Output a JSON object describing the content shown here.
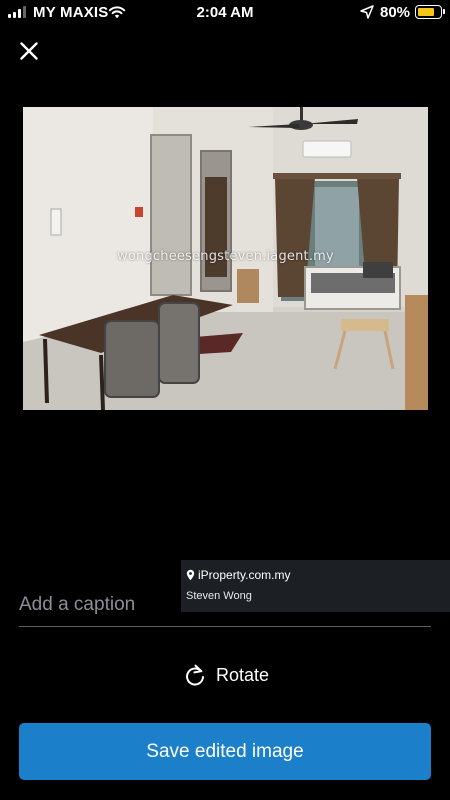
{
  "status_bar": {
    "carrier": "MY MAXIS",
    "time": "2:04 AM",
    "battery_percent": "80%",
    "battery_level": 0.8,
    "signal_bars_filled": 3,
    "signal_bars_total": 4
  },
  "photo": {
    "watermark": "wongcheesengsteven.iagent.my"
  },
  "badge": {
    "brand": "iProperty.com.my",
    "agent_name": "Steven Wong"
  },
  "caption": {
    "placeholder": "Add a caption",
    "value": ""
  },
  "actions": {
    "rotate_label": "Rotate",
    "save_label": "Save edited image"
  },
  "colors": {
    "background": "#000000",
    "primary_button": "#1b7fc9",
    "battery": "#f5c518"
  },
  "icons": {
    "close": "close-icon",
    "rotate": "rotate-clockwise-icon",
    "location": "location-arrow-icon",
    "wifi": "wifi-icon",
    "pin": "map-pin-icon"
  }
}
